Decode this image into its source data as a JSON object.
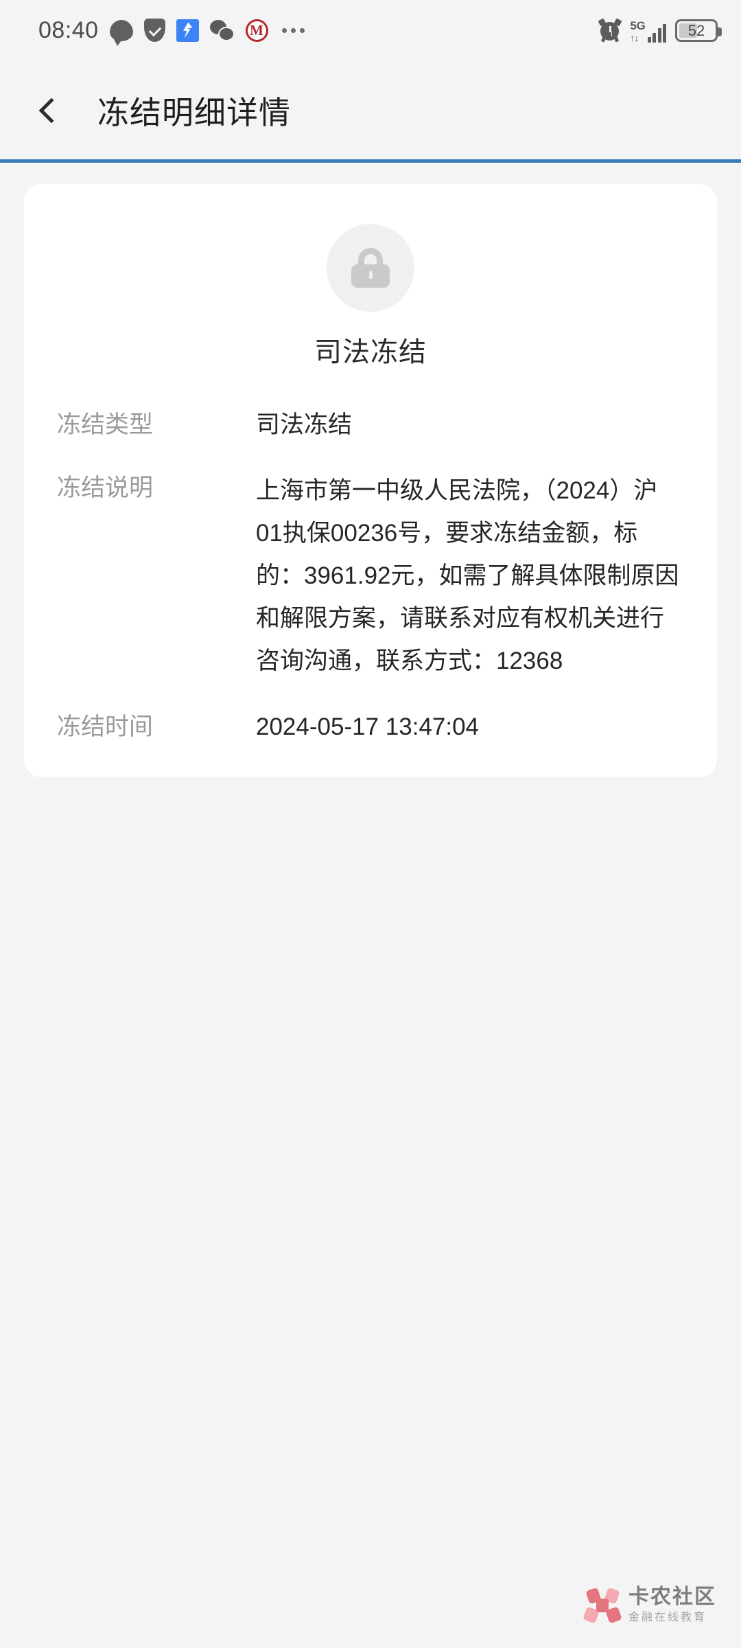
{
  "status_bar": {
    "time": "08:40",
    "left_icons": [
      "chat-bubble-icon",
      "shield-check-icon",
      "dingtalk-icon",
      "wechat-icon",
      "bank-logo-icon",
      "overflow-dots-icon"
    ],
    "alarm_icon": "alarm-clock-icon",
    "network_generation": "5G",
    "network_arrows": "↑↓",
    "signal_bars": 4,
    "battery_percent": "52",
    "battery_level": 52
  },
  "navbar": {
    "back_icon": "chevron-left-icon",
    "title": "冻结明细详情",
    "underline_color": "#3a7cb8"
  },
  "card": {
    "status_icon": "lock-icon",
    "status_title": "司法冻结",
    "rows": [
      {
        "label": "冻结类型",
        "value": "司法冻结"
      },
      {
        "label": "冻结说明",
        "value": "上海市第一中级人民法院，（2024）沪01执保00236号，要求冻结金额，标的：3961.92元，如需了解具体限制原因和解限方案，请联系对应有权机关进行咨询沟通，联系方式：12368"
      },
      {
        "label": "冻结时间",
        "value": "2024-05-17 13:47:04"
      }
    ]
  },
  "watermark": {
    "logo_icon": "flower-logo-icon",
    "title": "卡农社区",
    "subtitle": "金融在线教育"
  },
  "colors": {
    "page_background": "#f4f4f4",
    "card_background": "#ffffff",
    "accent_line": "#3a7cb8",
    "label_text": "#9a9a9a",
    "value_text": "#262626",
    "lock_circle": "#f0f0f0",
    "lock_glyph": "#cacaca"
  }
}
